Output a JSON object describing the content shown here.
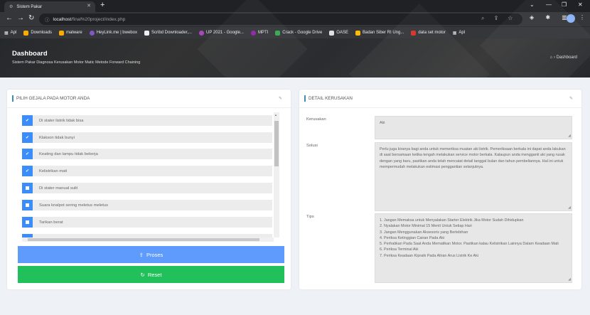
{
  "browser": {
    "tab_title": "Sistem Pakar",
    "url_host": "localhost",
    "url_path": "/final%20project/index.php",
    "bookmarks": [
      "Apl",
      "Downloads",
      "malware",
      "HeyLink.me | bwebox",
      "Scribd Downloader,...",
      "UP 2021 - Google...",
      "MPTI",
      "Crack - Google Drive",
      "OASE",
      "Badan Siber RI Ung...",
      "data set motor",
      "Apl"
    ]
  },
  "header": {
    "title": "Dashboard",
    "subtitle": "Sistem Pakar Diagnosa Kerusakan Motor Matic Metode Forward Chaining",
    "breadcrumb": "Dashboard"
  },
  "left_card": {
    "title": "PILIH GEJALA PADA MOTOR ANDA",
    "symptoms": [
      {
        "label": "Di stater listrik tidak bisa",
        "checked": true
      },
      {
        "label": "Klakson tidak bunyi",
        "checked": true
      },
      {
        "label": "Keating dan lampu tidak bekerja",
        "checked": true
      },
      {
        "label": "Kelistrikan mati",
        "checked": true
      },
      {
        "label": "Di stater manual sulit",
        "checked": false
      },
      {
        "label": "Suara knalpot sering meletus meletus",
        "checked": false
      },
      {
        "label": "Tarikan berat",
        "checked": false
      }
    ],
    "proses_label": "Proses",
    "reset_label": "Reset"
  },
  "right_card": {
    "title": "DETAIL KERUSAKAN",
    "kerusakan_label": "Kerusakan",
    "kerusakan_value": "Aki",
    "solusi_label": "Solusi",
    "solusi_value": "Perlu juga kiranya bagi anda untuk memeriksa muatan aki listrik. Pemeriksaan berkala ini dapat anda lakukan di saat bersamaan ketika tengah melakukan service motor berkala. Kalaupun anda mengganti aki yang rusak dengan yang baru, pastikan anda telah mencatat detail tanggal bulan dan tahun pembeliannya. Hal ini untuk mempermudah melakukan estimasi penggantian selanjutnya.",
    "tips_label": "Tips",
    "tips": [
      "1. Jangan Memaksa untuk Menyalakan Starter Elektrik Jika Motor Sudah Dihidupkan",
      "2. Nyalakan Motor Minimal 15 Menit Untuk Setiap Hari",
      "3. Jangan Menggunakan Aksesoris yang Berlebihan",
      "4. Periksa Ketinggian Cairan Pada Aki",
      "5. Perhatikan Pada Saat Anda Mematikan Motor. Pastikan kalau Kelistrikan Lainnya Dalam Keadaan Mati",
      "6. Periksa Terminal Aki",
      "7. Periksa Keadaan Kipratk Pada Aliran Arus Listrik Ke Aki"
    ]
  },
  "colors": {
    "primary": "#5e9bfd",
    "success": "#22c05a",
    "checkbox": "#3c8dfc"
  }
}
